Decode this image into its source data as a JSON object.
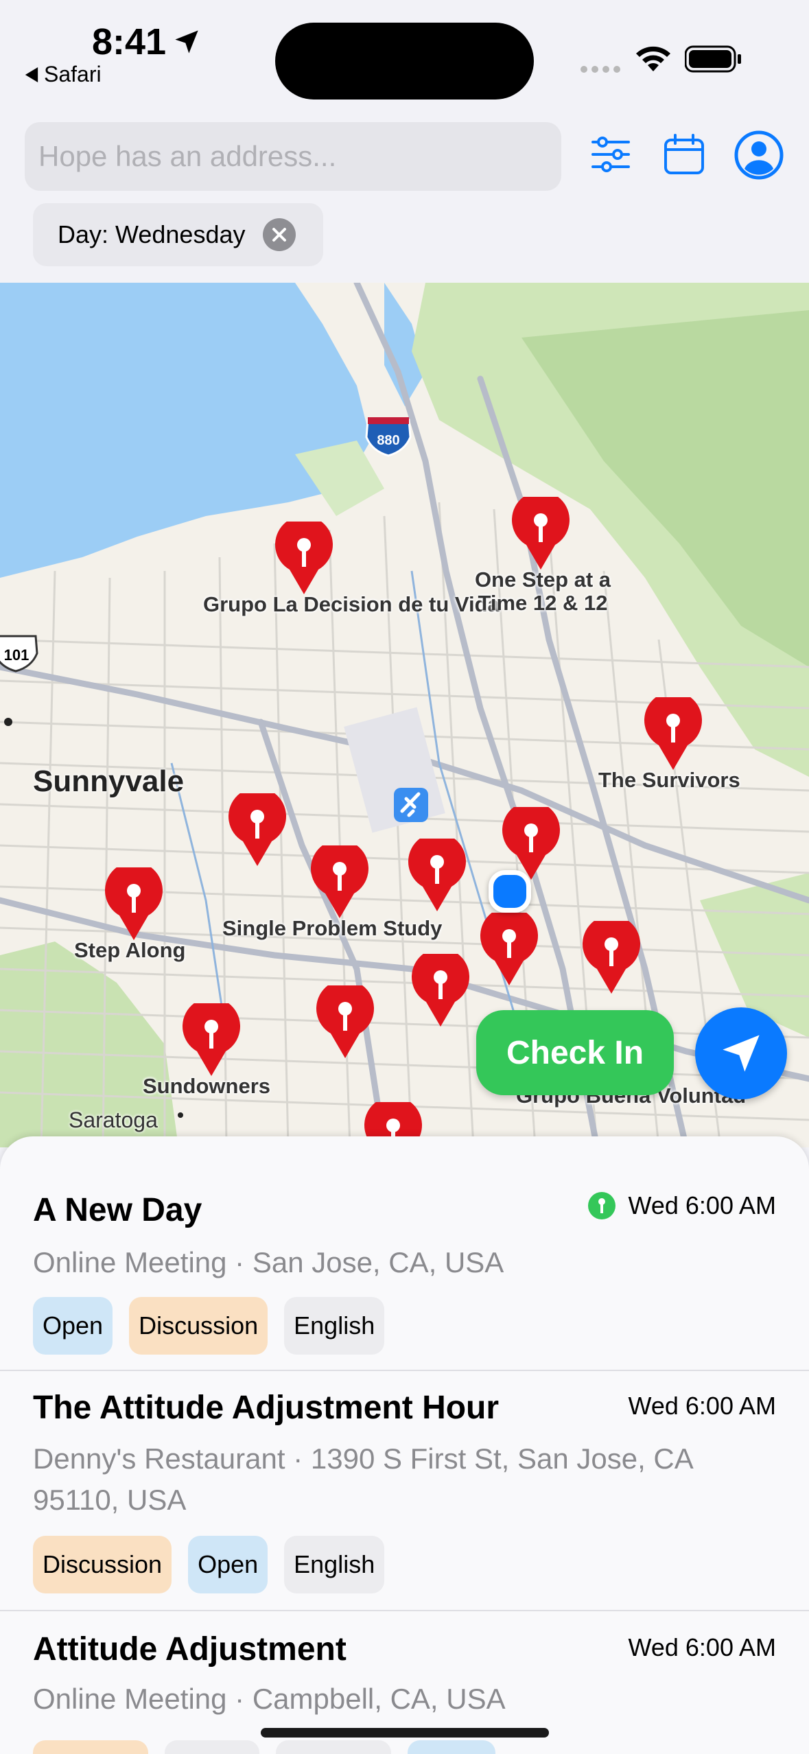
{
  "status_bar": {
    "time": "8:41",
    "back_app": "Safari"
  },
  "search": {
    "placeholder": "Hope has an address..."
  },
  "filter_chip": {
    "label": "Day: Wednesday"
  },
  "map": {
    "highway_880": "880",
    "highway_101": "101",
    "city_sunnyvale": "Sunnyvale",
    "city_saratoga": "Saratoga",
    "labels": {
      "grupo_la_decision": "Grupo La Decision de tu Vida",
      "one_step": "One Step at a Time 12 & 12",
      "the_survivors": "The Survivors",
      "single_problem": "Single Problem Study",
      "step_along": "Step Along",
      "sundowners": "Sundowners",
      "grupo_buena": "Grupo Buena Voluntad"
    }
  },
  "buttons": {
    "check_in": "Check In"
  },
  "meetings": [
    {
      "title": "A New Day",
      "time": "Wed 6:00 AM",
      "subtitle": "Online Meeting · San Jose, CA, USA",
      "tags": [
        "Open",
        "Discussion",
        "English"
      ]
    },
    {
      "title": "The Attitude Adjustment Hour",
      "time": "Wed 6:00 AM",
      "subtitle": "Denny's Restaurant · 1390 S First St, San Jose, CA 95110, USA",
      "tags": [
        "Discussion",
        "Open",
        "English"
      ]
    },
    {
      "title": "Attitude Adjustment",
      "time": "Wed 6:00 AM",
      "subtitle": "Online Meeting · Campbell, CA, USA",
      "tags": []
    }
  ]
}
